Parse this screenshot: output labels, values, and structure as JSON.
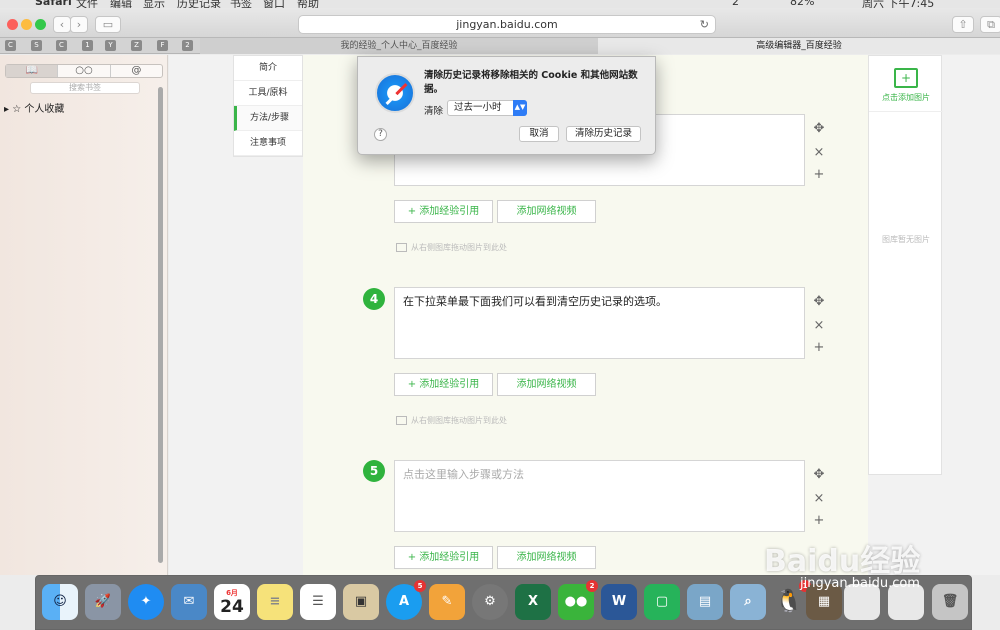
{
  "menubar": {
    "apple": "",
    "app": "Safari",
    "items": [
      "文件",
      "编辑",
      "显示",
      "历史记录",
      "书签",
      "窗口",
      "帮助"
    ],
    "status_right": {
      "wechat_count": "2",
      "battery": "82%",
      "clock": "周六 下午7:45"
    }
  },
  "toolbar": {
    "back": "‹",
    "forward": "›",
    "address": "jingyan.baidu.com",
    "reload": "↻"
  },
  "favorites": [
    "C",
    "S",
    "C",
    "1",
    "Y",
    "Z",
    "F",
    "2"
  ],
  "tabs": [
    {
      "label": "我的经验_个人中心_百度经验"
    },
    {
      "label": "高级编辑器_百度经验"
    }
  ],
  "sidebar": {
    "segments": [
      "📖",
      "○○",
      "@"
    ],
    "search_placeholder": "搜索书签",
    "item": "个人收藏"
  },
  "step_nav": [
    "简介",
    "工具/原料",
    "方法/步骤",
    "注意事项"
  ],
  "steps": [
    {
      "number": "",
      "text": ""
    },
    {
      "number": "4",
      "text": "在下拉菜单最下面我们可以看到清空历史记录的选项。"
    },
    {
      "number": "5",
      "text": "点击这里输入步骤或方法"
    }
  ],
  "step_controls": {
    "move": "✥",
    "delete": "×",
    "add": "+"
  },
  "buttons": {
    "add_ref": "+ 添加经验引用",
    "add_video": "添加网络视频"
  },
  "drag_hint": "从右侧图库拖动图片到此处",
  "gallery": {
    "add_label": "点击添加图片",
    "empty_label": "图库暂无图片"
  },
  "dialog": {
    "message": "清除历史记录将移除相关的 Cookie 和其他网站数据。",
    "clear_label": "清除",
    "range_value": "过去一小时",
    "help": "?",
    "cancel": "取消",
    "confirm": "清除历史记录"
  },
  "dock": {
    "calendar_month": "6月",
    "calendar_day": "24",
    "badges": {
      "appstore": "5",
      "wechat": "2",
      "qq": "1"
    }
  },
  "watermark": {
    "brand": "Baidu经验",
    "url": "jingyan.baidu.com"
  },
  "colors": {
    "accent_green": "#3ab549",
    "dialog_select_blue": "#2e7cf6"
  }
}
